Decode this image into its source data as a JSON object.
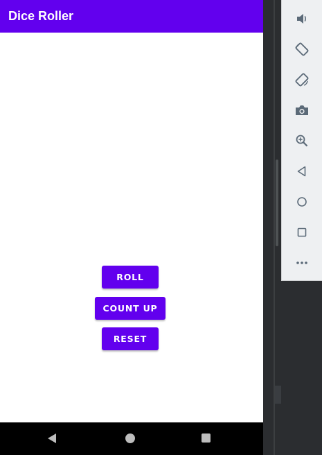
{
  "app": {
    "title": "Dice Roller"
  },
  "buttons": {
    "roll": "ROLL",
    "count_up": "COUNT UP",
    "reset": "RESET"
  },
  "colors": {
    "primary": "#6200ee",
    "background": "#ffffff",
    "nav_bar": "#000000",
    "toolbar_bg": "#eef0f2",
    "toolbar_icon": "#5b6a78"
  },
  "system_nav": {
    "back": "back-icon",
    "home": "home-icon",
    "recents": "recents-icon"
  },
  "emulator_toolbar": [
    "volume-icon",
    "rotate-left-icon",
    "rotate-right-icon",
    "camera-icon",
    "zoom-icon",
    "back-icon",
    "home-icon",
    "overview-icon",
    "more-icon"
  ]
}
